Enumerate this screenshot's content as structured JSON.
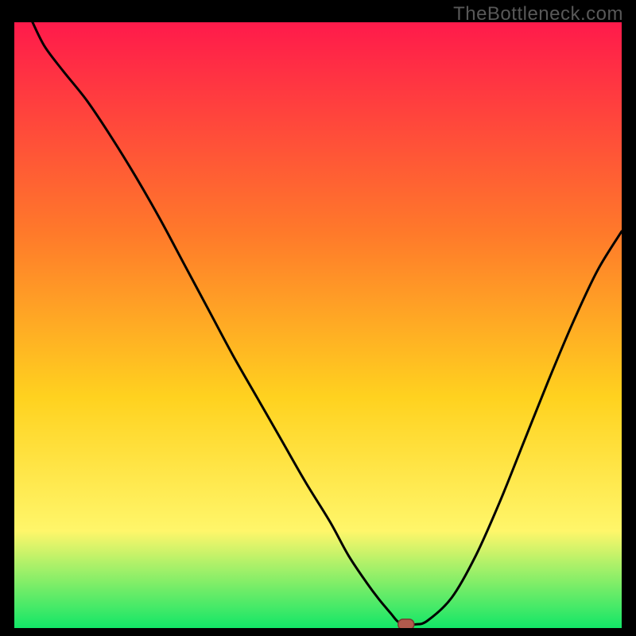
{
  "watermark": "TheBottleneck.com",
  "colors": {
    "gradient_top": "#ff1a4b",
    "gradient_mid1": "#ff7a2a",
    "gradient_mid2": "#ffd21f",
    "gradient_mid3": "#fff66a",
    "gradient_bottom": "#12e667",
    "curve": "#000000",
    "marker_fill": "#b15a4c",
    "marker_stroke": "#7a3a30",
    "frame": "#000000"
  },
  "chart_data": {
    "type": "line",
    "title": "",
    "xlabel": "",
    "ylabel": "",
    "xlim": [
      0,
      100
    ],
    "ylim": [
      0,
      100
    ],
    "grid": false,
    "legend": false,
    "annotations": [],
    "series": [
      {
        "name": "bottleneck-curve",
        "x": [
          3,
          5,
          8,
          12,
          16,
          20,
          24,
          28,
          32,
          36,
          40,
          44,
          48,
          52,
          55,
          58,
          60,
          62,
          63,
          64,
          66,
          68,
          72,
          76,
          80,
          84,
          88,
          92,
          96,
          100
        ],
        "y": [
          100,
          96,
          92,
          87,
          81,
          74.5,
          67.5,
          60,
          52.5,
          45,
          38,
          31,
          24,
          17.5,
          12,
          7.5,
          4.8,
          2.4,
          1.2,
          0.6,
          0.6,
          1.2,
          5,
          12,
          21,
          31,
          41,
          50.5,
          59,
          65.5
        ]
      }
    ],
    "marker": {
      "x": 64.5,
      "y": 0.6
    }
  }
}
